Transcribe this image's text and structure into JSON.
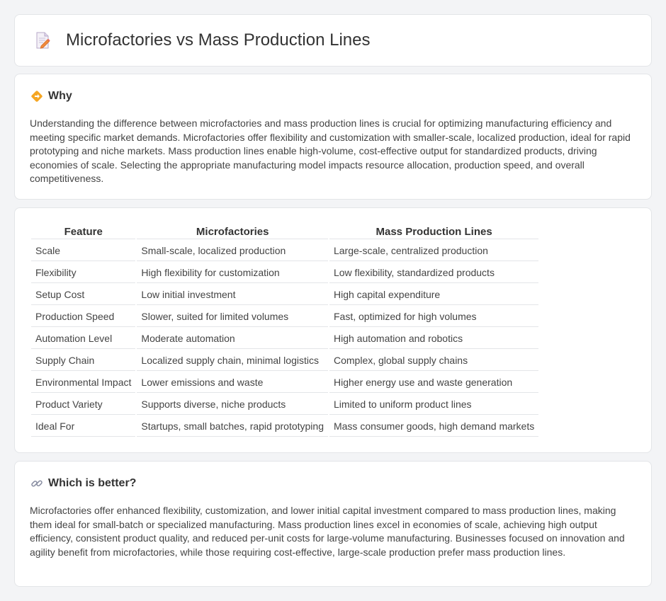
{
  "header": {
    "title": "Microfactories vs Mass Production Lines",
    "icon": "document-pencil-icon"
  },
  "why": {
    "heading": "Why",
    "icon": "diamond-arrow-icon",
    "text": "Understanding the difference between microfactories and mass production lines is crucial for optimizing manufacturing efficiency and meeting specific market demands. Microfactories offer flexibility and customization with smaller-scale, localized production, ideal for rapid prototyping and niche markets. Mass production lines enable high-volume, cost-effective output for standardized products, driving economies of scale. Selecting the appropriate manufacturing model impacts resource allocation, production speed, and overall competitiveness."
  },
  "table": {
    "headers": [
      "Feature",
      "Microfactories",
      "Mass Production Lines"
    ],
    "rows": [
      [
        "Scale",
        "Small-scale, localized production",
        "Large-scale, centralized production"
      ],
      [
        "Flexibility",
        "High flexibility for customization",
        "Low flexibility, standardized products"
      ],
      [
        "Setup Cost",
        "Low initial investment",
        "High capital expenditure"
      ],
      [
        "Production Speed",
        "Slower, suited for limited volumes",
        "Fast, optimized for high volumes"
      ],
      [
        "Automation Level",
        "Moderate automation",
        "High automation and robotics"
      ],
      [
        "Supply Chain",
        "Localized supply chain, minimal logistics",
        "Complex, global supply chains"
      ],
      [
        "Environmental Impact",
        "Lower emissions and waste",
        "Higher energy use and waste generation"
      ],
      [
        "Product Variety",
        "Supports diverse, niche products",
        "Limited to uniform product lines"
      ],
      [
        "Ideal For",
        "Startups, small batches, rapid prototyping",
        "Mass consumer goods, high demand markets"
      ]
    ]
  },
  "better": {
    "heading": "Which is better?",
    "icon": "link-icon",
    "text": "Microfactories offer enhanced flexibility, customization, and lower initial capital investment compared to mass production lines, making them ideal for small-batch or specialized manufacturing. Mass production lines excel in economies of scale, achieving high output efficiency, consistent product quality, and reduced per-unit costs for large-volume manufacturing. Businesses focused on innovation and agility benefit from microfactories, while those requiring cost-effective, large-scale production prefer mass production lines."
  },
  "colors": {
    "background": "#f3f4f6",
    "card": "#ffffff",
    "border": "#e3e5e8",
    "accent_orange": "#f5a623"
  }
}
